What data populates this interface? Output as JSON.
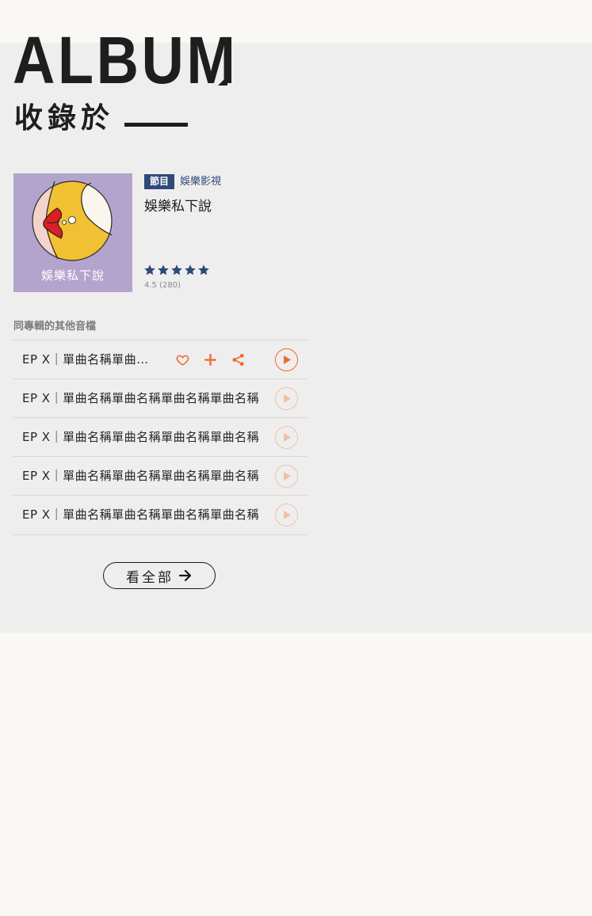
{
  "header": {
    "title_en": "ALBUM",
    "title_zh": "收錄於"
  },
  "album": {
    "cover_text": "娛樂私下說",
    "tag": "節目",
    "category": "娛樂影視",
    "title": "娛樂私下說",
    "stars": 5,
    "rating": "4.5 (280)"
  },
  "tracks_section": {
    "label": "同專輯的其他音檔",
    "items": [
      {
        "title": "EP X｜單曲名稱單曲名稱單曲名稱單曲名稱",
        "active": true
      },
      {
        "title": "EP X｜單曲名稱單曲名稱單曲名稱單曲名稱",
        "active": false
      },
      {
        "title": "EP X｜單曲名稱單曲名稱單曲名稱單曲名稱",
        "active": false
      },
      {
        "title": "EP X｜單曲名稱單曲名稱單曲名稱單曲名稱",
        "active": false
      },
      {
        "title": "EP X｜單曲名稱單曲名稱單曲名稱單曲名稱",
        "active": false
      }
    ]
  },
  "view_all": {
    "label": "看全部"
  },
  "icons": {
    "favorite": "heart-icon",
    "add": "plus-icon",
    "share": "share-icon",
    "play": "play-icon",
    "arrow": "arrow-right-icon",
    "star": "star-icon"
  },
  "colors": {
    "accent": "#ee6b2f",
    "accent_faded": "#f3c0a6",
    "brand_blue": "#2e4a7a",
    "cover_bg": "#b3a4cd",
    "panel_bg": "#efeeee"
  }
}
